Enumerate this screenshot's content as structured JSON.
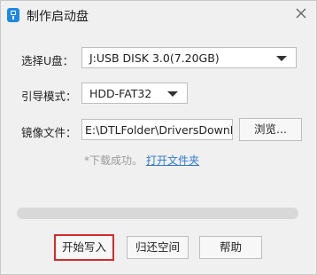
{
  "window": {
    "title": "制作启动盘"
  },
  "icons": {
    "app": "usb-app-icon",
    "close": "close-icon",
    "dropdown": "chevron-down-icon"
  },
  "form": {
    "drive_label": "选择U盘：",
    "drive_value": "J:USB DISK 3.0(7.20GB)",
    "boot_label": "引导模式：",
    "boot_value": "HDD-FAT32",
    "image_label": "镜像文件：",
    "image_value": "E:\\DTLFolder\\DriversDownLoad",
    "browse_label": "浏览..."
  },
  "status": {
    "message": "*下载成功。",
    "link": "打开文件夹"
  },
  "progress": {
    "value": 0
  },
  "buttons": {
    "start": "开始写入",
    "restore": "归还空间",
    "help": "帮助"
  },
  "colors": {
    "accent": "#1e88e5",
    "link": "#2f7bd6",
    "highlight": "#d42b2b"
  }
}
